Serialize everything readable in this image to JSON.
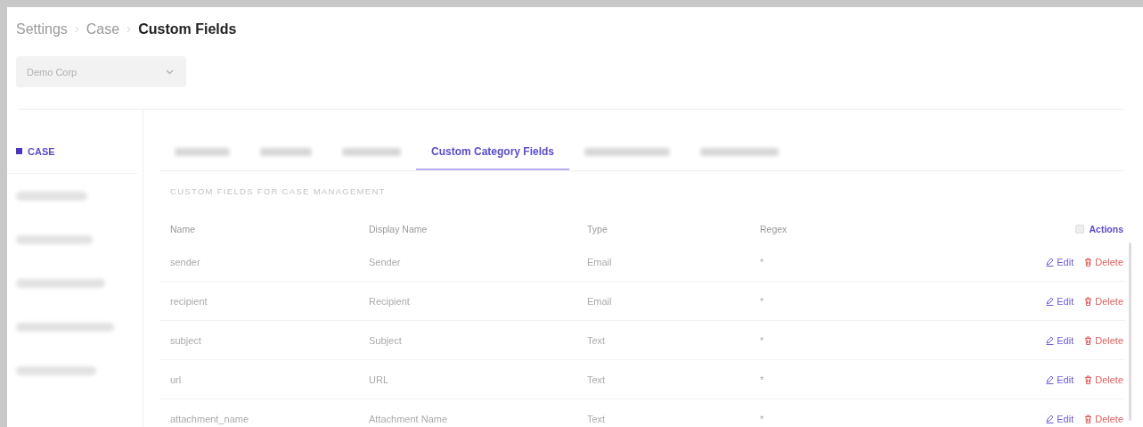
{
  "breadcrumb": [
    {
      "label": "Settings",
      "current": false
    },
    {
      "label": "Case",
      "current": false
    },
    {
      "label": "Custom Fields",
      "current": true
    }
  ],
  "org_select": {
    "value": "Demo Corp"
  },
  "sidebar": {
    "items": [
      {
        "kind": "label",
        "label": "CASE",
        "selected": true
      },
      {
        "kind": "redacted",
        "selected": false
      },
      {
        "kind": "redacted",
        "selected": false
      },
      {
        "kind": "redacted",
        "selected": false
      },
      {
        "kind": "redacted",
        "selected": false
      },
      {
        "kind": "redacted",
        "selected": false
      }
    ]
  },
  "tabs": [
    {
      "kind": "redacted",
      "selected": false
    },
    {
      "kind": "redacted",
      "selected": false
    },
    {
      "kind": "redacted",
      "selected": false
    },
    {
      "kind": "label",
      "label": "Custom Category Fields",
      "selected": true
    },
    {
      "kind": "redacted",
      "selected": false
    },
    {
      "kind": "redacted",
      "selected": false
    }
  ],
  "section_title": "CUSTOM FIELDS FOR CASE MANAGEMENT",
  "table": {
    "columns": [
      "Name",
      "Display Name",
      "Type",
      "Regex",
      "Actions"
    ],
    "rows": [
      {
        "name": "sender",
        "display_name": "Sender",
        "type": "Email",
        "regex": "*",
        "edit": "Edit",
        "delete": "Delete"
      },
      {
        "name": "recipient",
        "display_name": "Recipient",
        "type": "Email",
        "regex": "*",
        "edit": "Edit",
        "delete": "Delete"
      },
      {
        "name": "subject",
        "display_name": "Subject",
        "type": "Text",
        "regex": "*",
        "edit": "Edit",
        "delete": "Delete"
      },
      {
        "name": "url",
        "display_name": "URL",
        "type": "Text",
        "regex": "*",
        "edit": "Edit",
        "delete": "Delete"
      },
      {
        "name": "attachment_name",
        "display_name": "Attachment Name",
        "type": "Text",
        "regex": "*",
        "edit": "Edit",
        "delete": "Delete"
      }
    ]
  }
}
